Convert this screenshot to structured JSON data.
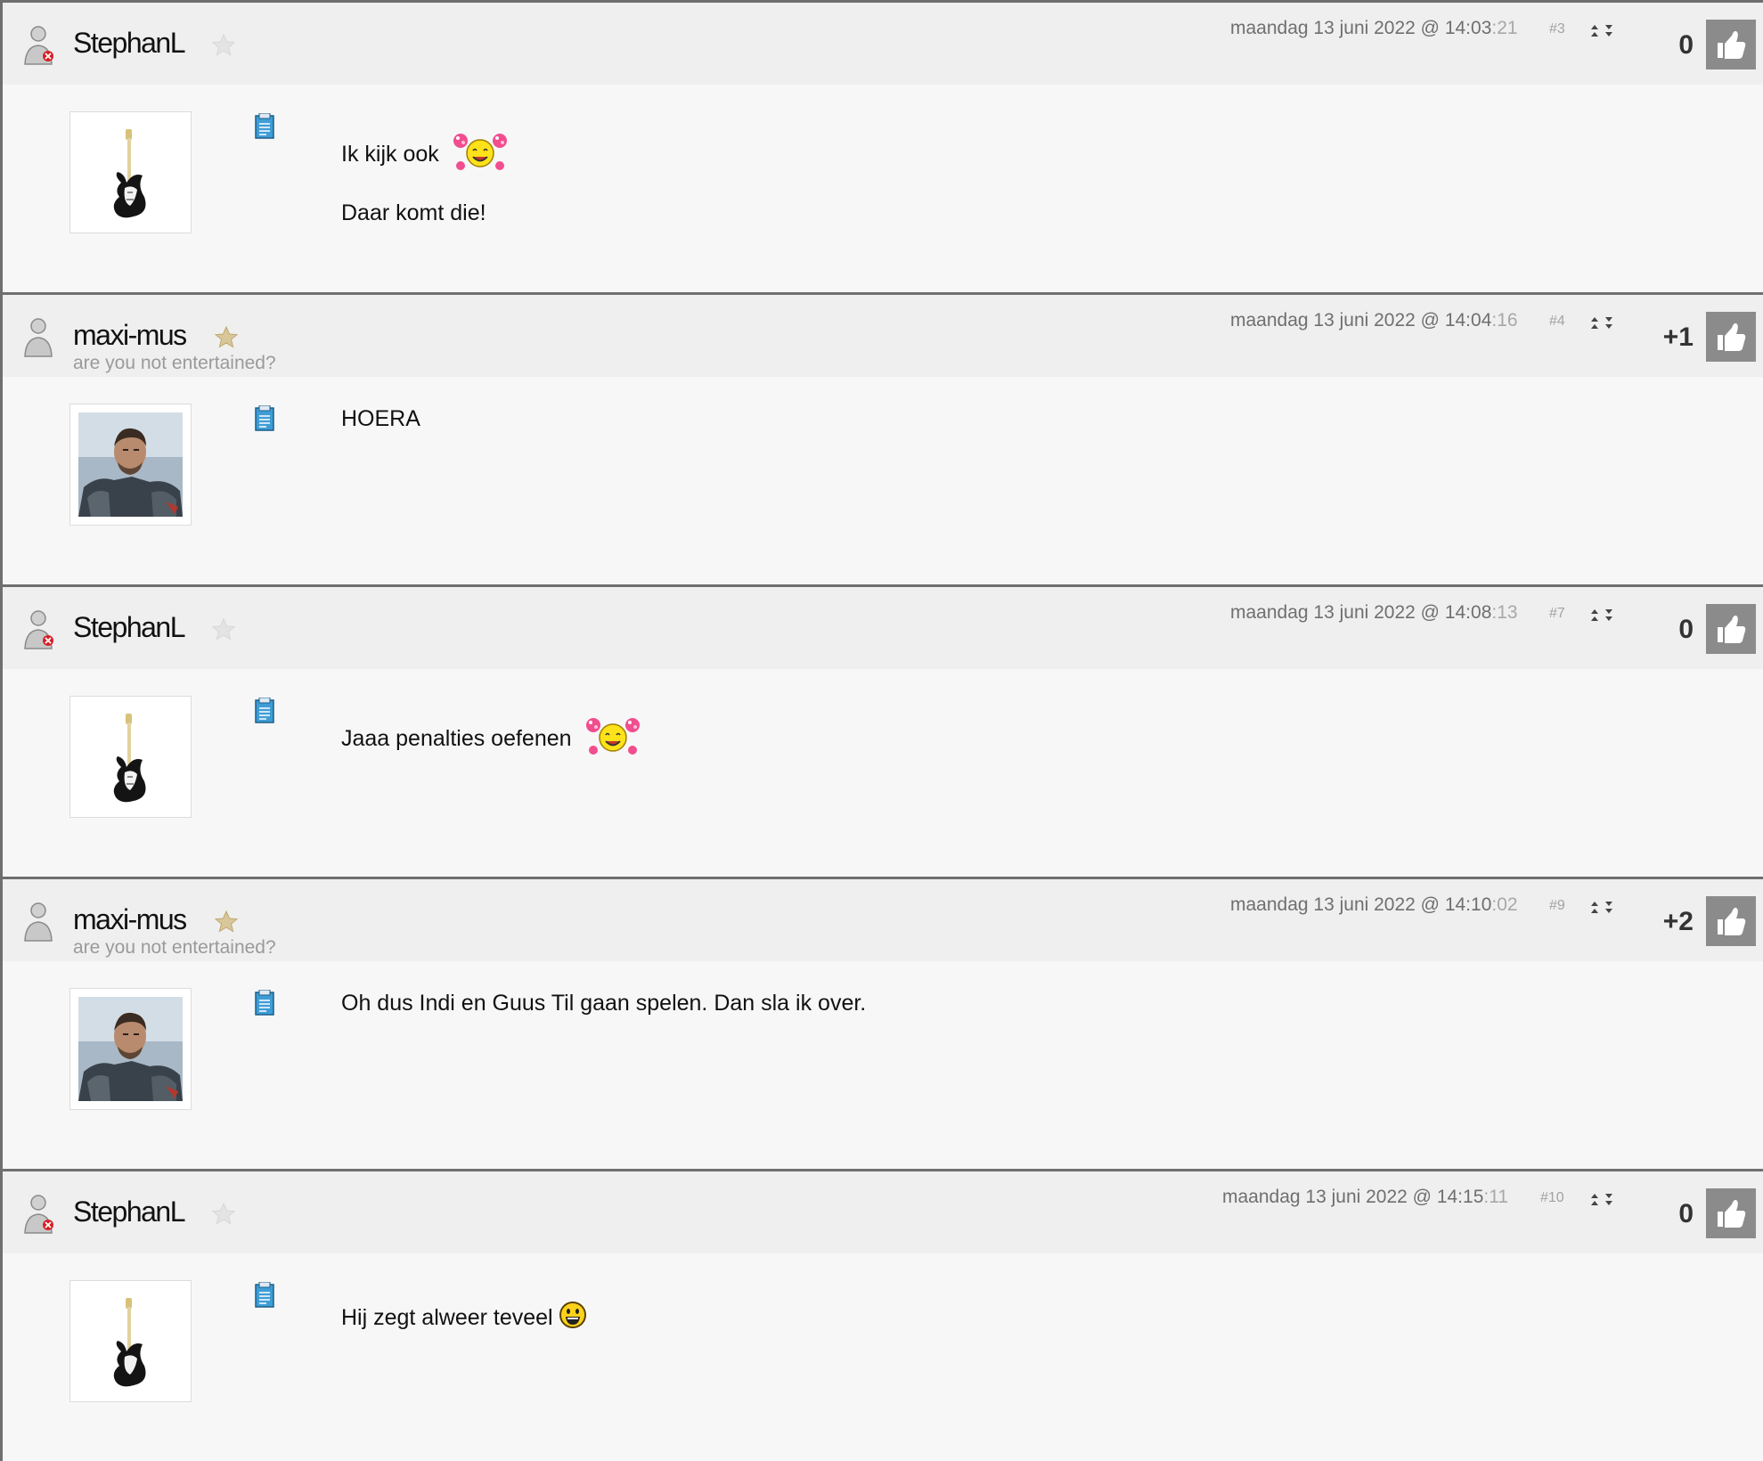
{
  "posts": [
    {
      "username": "StephanL",
      "date": "maandag 13 juni 2022 @ 14:03",
      "seconds": ":21",
      "post_number": "#3",
      "score": "0",
      "body": [
        {
          "text": "Ik kijk ook",
          "smiley": "cheerleader-smiley"
        },
        {
          "text": "Daar komt die!"
        }
      ]
    },
    {
      "username": "maxi-mus",
      "title": "are you not entertained?",
      "date": "maandag 13 juni 2022 @ 14:04",
      "seconds": ":16",
      "post_number": "#4",
      "score": "+1",
      "body": [
        {
          "text": "HOERA"
        }
      ]
    },
    {
      "username": "StephanL",
      "date": "maandag 13 juni 2022 @ 14:08",
      "seconds": ":13",
      "post_number": "#7",
      "score": "0",
      "body": [
        {
          "text": "Jaaa penalties oefenen",
          "smiley": "cheerleader-smiley"
        }
      ]
    },
    {
      "username": "maxi-mus",
      "title": "are you not entertained?",
      "date": "maandag 13 juni 2022 @ 14:10",
      "seconds": ":02",
      "post_number": "#9",
      "score": "+2",
      "body": [
        {
          "text": "Oh dus Indi en Guus Til gaan spelen. Dan sla ik over."
        }
      ]
    },
    {
      "username": "StephanL",
      "date": "maandag 13 juni 2022 @ 14:15",
      "seconds": ":11",
      "post_number": "#10",
      "score": "0",
      "body": [
        {
          "text": "Hij zegt alweer teveel",
          "smiley": "grinning-smiley"
        }
      ]
    }
  ],
  "icons": {
    "user": "user-icon",
    "star": "star-icon",
    "note": "note-icon",
    "nav": "up-down-arrows-icon",
    "vote": "thumbs-up-icon"
  },
  "colors": {
    "post_border": "#6f6f6f",
    "header_bg": "#efefef",
    "body_bg": "#f7f7f7",
    "vote_button": "#8b8b8b",
    "star_gold": "#d8c79a",
    "note_blue": "#2a8bc4"
  }
}
